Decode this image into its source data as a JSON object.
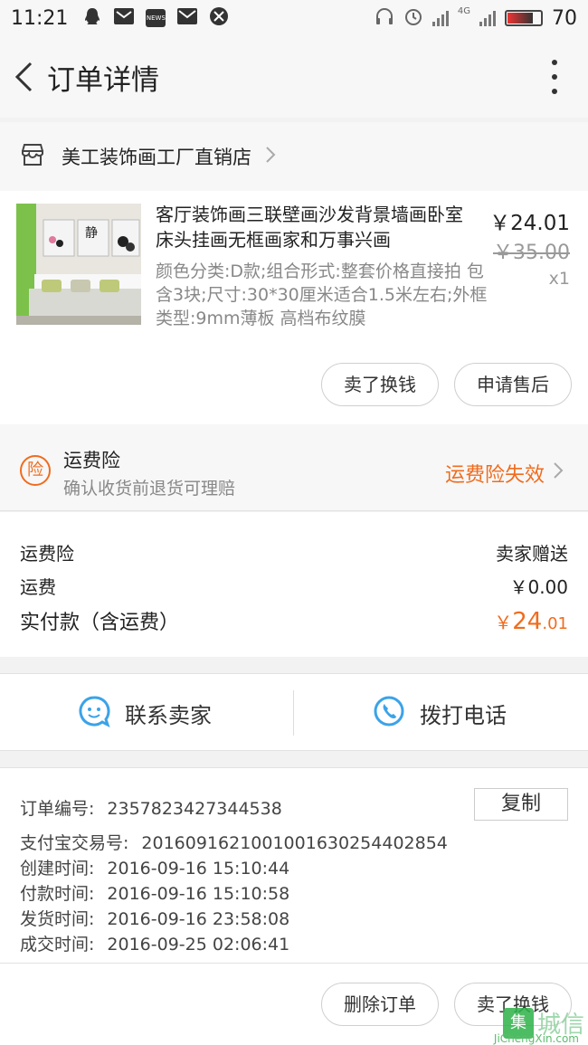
{
  "status_bar": {
    "time": "11:21",
    "news_icon_text": "NEWS",
    "network": "4G",
    "battery": "70"
  },
  "header": {
    "title": "订单详情"
  },
  "shop": {
    "name": "美工装饰画工厂直销店"
  },
  "product": {
    "title": "客厅装饰画三联壁画沙发背景墙画卧室床头挂画无框画家和万事兴画",
    "attributes": "颜色分类:D款;组合形式:整套价格直接拍 包含3块;尺寸:30*30厘米适合1.5米左右;外框类型:9mm薄板 高档布纹膜",
    "price": "￥24.01",
    "original_price": "￥35.00",
    "quantity": "x1",
    "thumb_text": "静"
  },
  "item_actions": {
    "sell_label": "卖了换钱",
    "after_sale_label": "申请售后"
  },
  "insurance": {
    "icon_text": "险",
    "title": "运费险",
    "description": "确认收货前退货可理赔",
    "status": "运费险失效"
  },
  "costs": {
    "insurance_label": "运费险",
    "insurance_value": "卖家赠送",
    "shipping_label": "运费",
    "shipping_value": "￥0.00",
    "paid_label": "实付款（含运费）",
    "paid_symbol": "￥",
    "paid_integer": "24",
    "paid_decimal": ".01"
  },
  "contact": {
    "seller_label": "联系卖家",
    "phone_label": "拨打电话"
  },
  "order_info": {
    "order_no_label": "订单编号:",
    "order_no": "2357823427344538",
    "copy_label": "复制",
    "alipay_label": "支付宝交易号:",
    "alipay_no": "2016091621001001630254402854",
    "created_label": "创建时间:",
    "created": "2016-09-16 15:10:44",
    "paid_label": "付款时间:",
    "paid": "2016-09-16 15:10:58",
    "shipped_label": "发货时间:",
    "shipped": "2016-09-16 23:58:08",
    "completed_label": "成交时间:",
    "completed": "2016-09-25 02:06:41"
  },
  "bottom_actions": {
    "delete_label": "删除订单",
    "sell_label": "卖了换钱"
  },
  "watermark": {
    "logo": "集",
    "text": "城信",
    "url": "JiChengXin.com"
  },
  "colors": {
    "accent_orange": "#f06c1e",
    "contact_blue": "#3ba3e8",
    "background": "#f2f2f2"
  }
}
